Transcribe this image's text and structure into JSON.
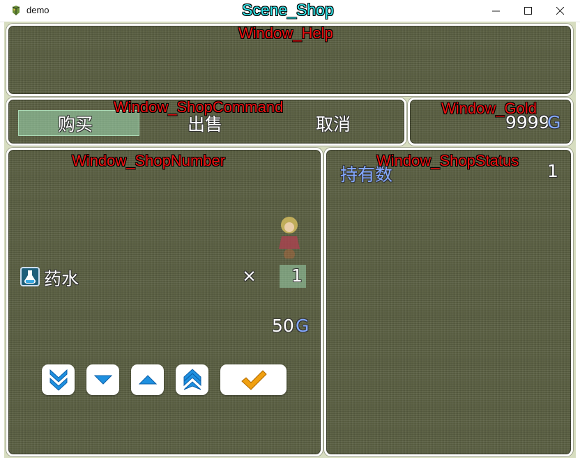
{
  "window": {
    "title": "demo"
  },
  "scene": {
    "label": "Scene_Shop"
  },
  "windows": {
    "help": {
      "label": "Window_Help"
    },
    "command": {
      "label": "Window_ShopCommand"
    },
    "gold": {
      "label": "Window_Gold"
    },
    "number": {
      "label": "Window_ShopNumber"
    },
    "status": {
      "label": "Window_ShopStatus"
    }
  },
  "command": {
    "buy": "购买",
    "sell": "出售",
    "cancel": "取消",
    "selected": "buy"
  },
  "gold": {
    "amount": "9999",
    "unit": "G"
  },
  "number": {
    "item_name": "药水",
    "item_icon": "potion-icon",
    "times": "×",
    "quantity": "1",
    "price": "50",
    "price_unit": "G",
    "buttons": [
      {
        "name": "down-ten-button",
        "icon": "double-chevron-down-icon"
      },
      {
        "name": "down-one-button",
        "icon": "triangle-down-icon"
      },
      {
        "name": "up-one-button",
        "icon": "triangle-up-icon"
      },
      {
        "name": "up-ten-button",
        "icon": "double-chevron-up-icon"
      },
      {
        "name": "ok-button",
        "icon": "checkmark-icon"
      }
    ]
  },
  "status": {
    "possession_label": "持有数",
    "possession_value": "1"
  },
  "colors": {
    "window_bg": "#5a5f42",
    "window_border": "#ffffff",
    "label_red": "#ee1111",
    "scene_cyan": "#33e6ea",
    "system_blue": "#84a9ff",
    "button_blue": "#1e90e0",
    "check_orange": "#f0a010"
  }
}
